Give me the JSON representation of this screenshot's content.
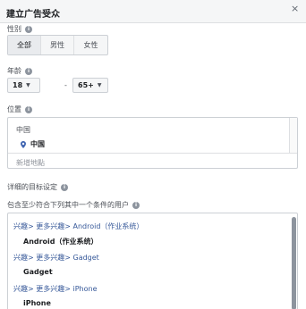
{
  "header": {
    "title": "建立广告受众",
    "close": "×"
  },
  "gender": {
    "label": "性别",
    "options": [
      "全部",
      "男性",
      "女性"
    ],
    "selected": "全部"
  },
  "age": {
    "label": "年龄",
    "min": "18",
    "separator": "-",
    "max": "65+"
  },
  "location": {
    "label": "位置",
    "country": "中国",
    "item": "中国",
    "add_placeholder": "新增地點"
  },
  "detailed": {
    "label": "详细的目标设定",
    "include_label": "包含至少符合下列其中一个条件的用户",
    "entries": [
      {
        "path": "兴趣> 更多兴趣> Android（作业系统）",
        "name": "Android（作业系统）"
      },
      {
        "path": "兴趣> 更多兴趣> Gadget",
        "name": "Gadget"
      },
      {
        "path": "兴趣> 更多兴趣> iPhone",
        "name": "iPhone"
      }
    ]
  },
  "colors": {
    "link": "#365899",
    "info_icon": "#8d949e",
    "border": "#ccd0d5"
  },
  "icons": [
    "close-icon",
    "info-icon",
    "chevron-down-icon",
    "map-pin-icon"
  ]
}
